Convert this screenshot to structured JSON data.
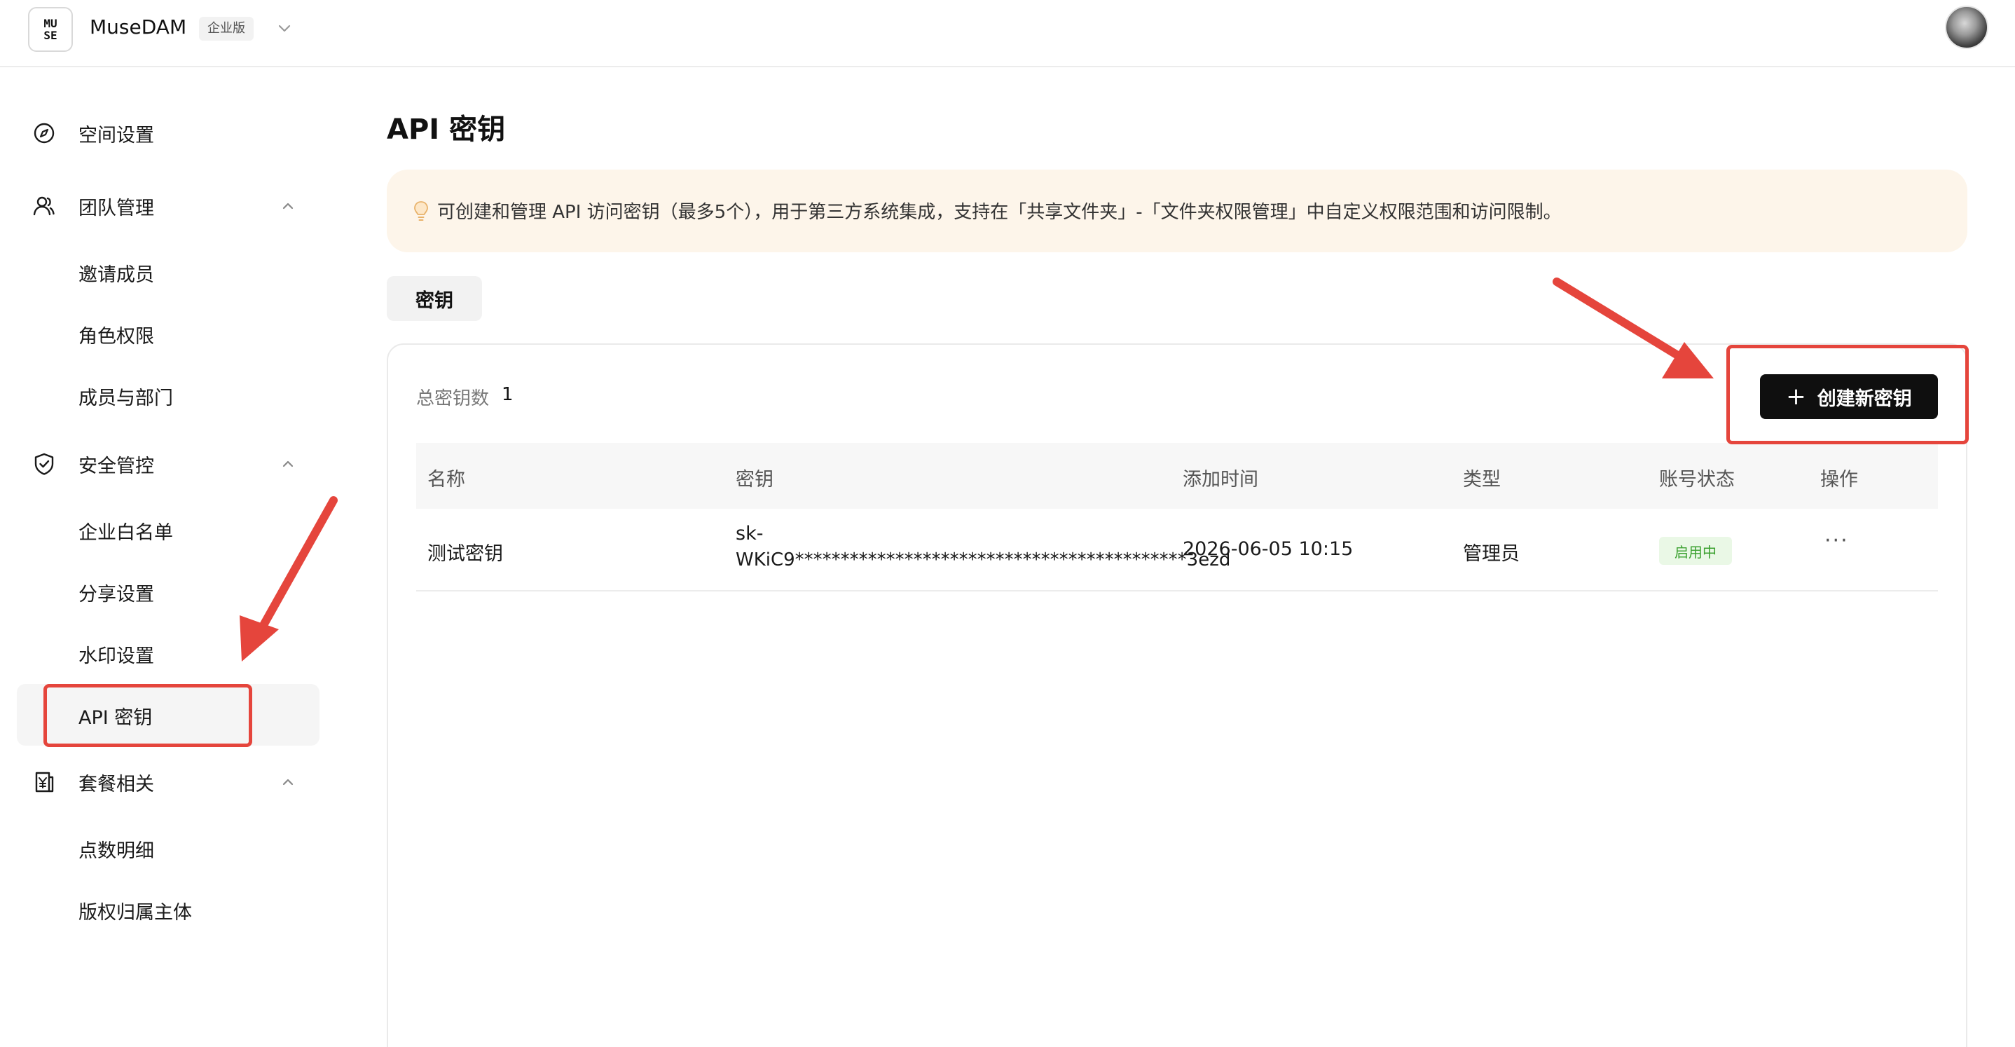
{
  "header": {
    "logo_line1": "MU",
    "logo_line2": "SE",
    "app_name": "MuseDAM",
    "edition": "企业版"
  },
  "sidebar": {
    "groups": [
      {
        "label": "空间设置",
        "icon": "compass-icon"
      },
      {
        "label": "团队管理",
        "icon": "team-icon",
        "expanded": true,
        "items": [
          "邀请成员",
          "角色权限",
          "成员与部门"
        ]
      },
      {
        "label": "安全管控",
        "icon": "shield-icon",
        "expanded": true,
        "items": [
          "企业白名单",
          "分享设置",
          "水印设置",
          "API 密钥"
        ]
      },
      {
        "label": "套餐相关",
        "icon": "plan-icon",
        "expanded": true,
        "items": [
          "点数明细",
          "版权归属主体"
        ]
      }
    ],
    "active_item": "API 密钥"
  },
  "main": {
    "title": "API 密钥",
    "tip": "可创建和管理 API 访问密钥（最多5个），用于第三方系统集成，支持在「共享文件夹」-「文件夹权限管理」中自定义权限范围和访问限制。",
    "tab": "密钥",
    "total_label": "总密钥数",
    "total_count": "1",
    "create_button": "创建新密钥",
    "table": {
      "headers": [
        "名称",
        "密钥",
        "添加时间",
        "类型",
        "账号状态",
        "操作"
      ],
      "rows": [
        {
          "name": "测试密钥",
          "key_line1": "sk-",
          "key_line2": "WKiC9*******************************************3ezd",
          "added": "2026-06-05 10:15",
          "type": "管理员",
          "status": "启用中",
          "action": "···"
        }
      ]
    }
  },
  "colors": {
    "accent_dark": "#0f0f0f",
    "tip_bg": "#fdf5ea",
    "status_green": "#3ba12f",
    "annotation_red": "#e5453c"
  }
}
